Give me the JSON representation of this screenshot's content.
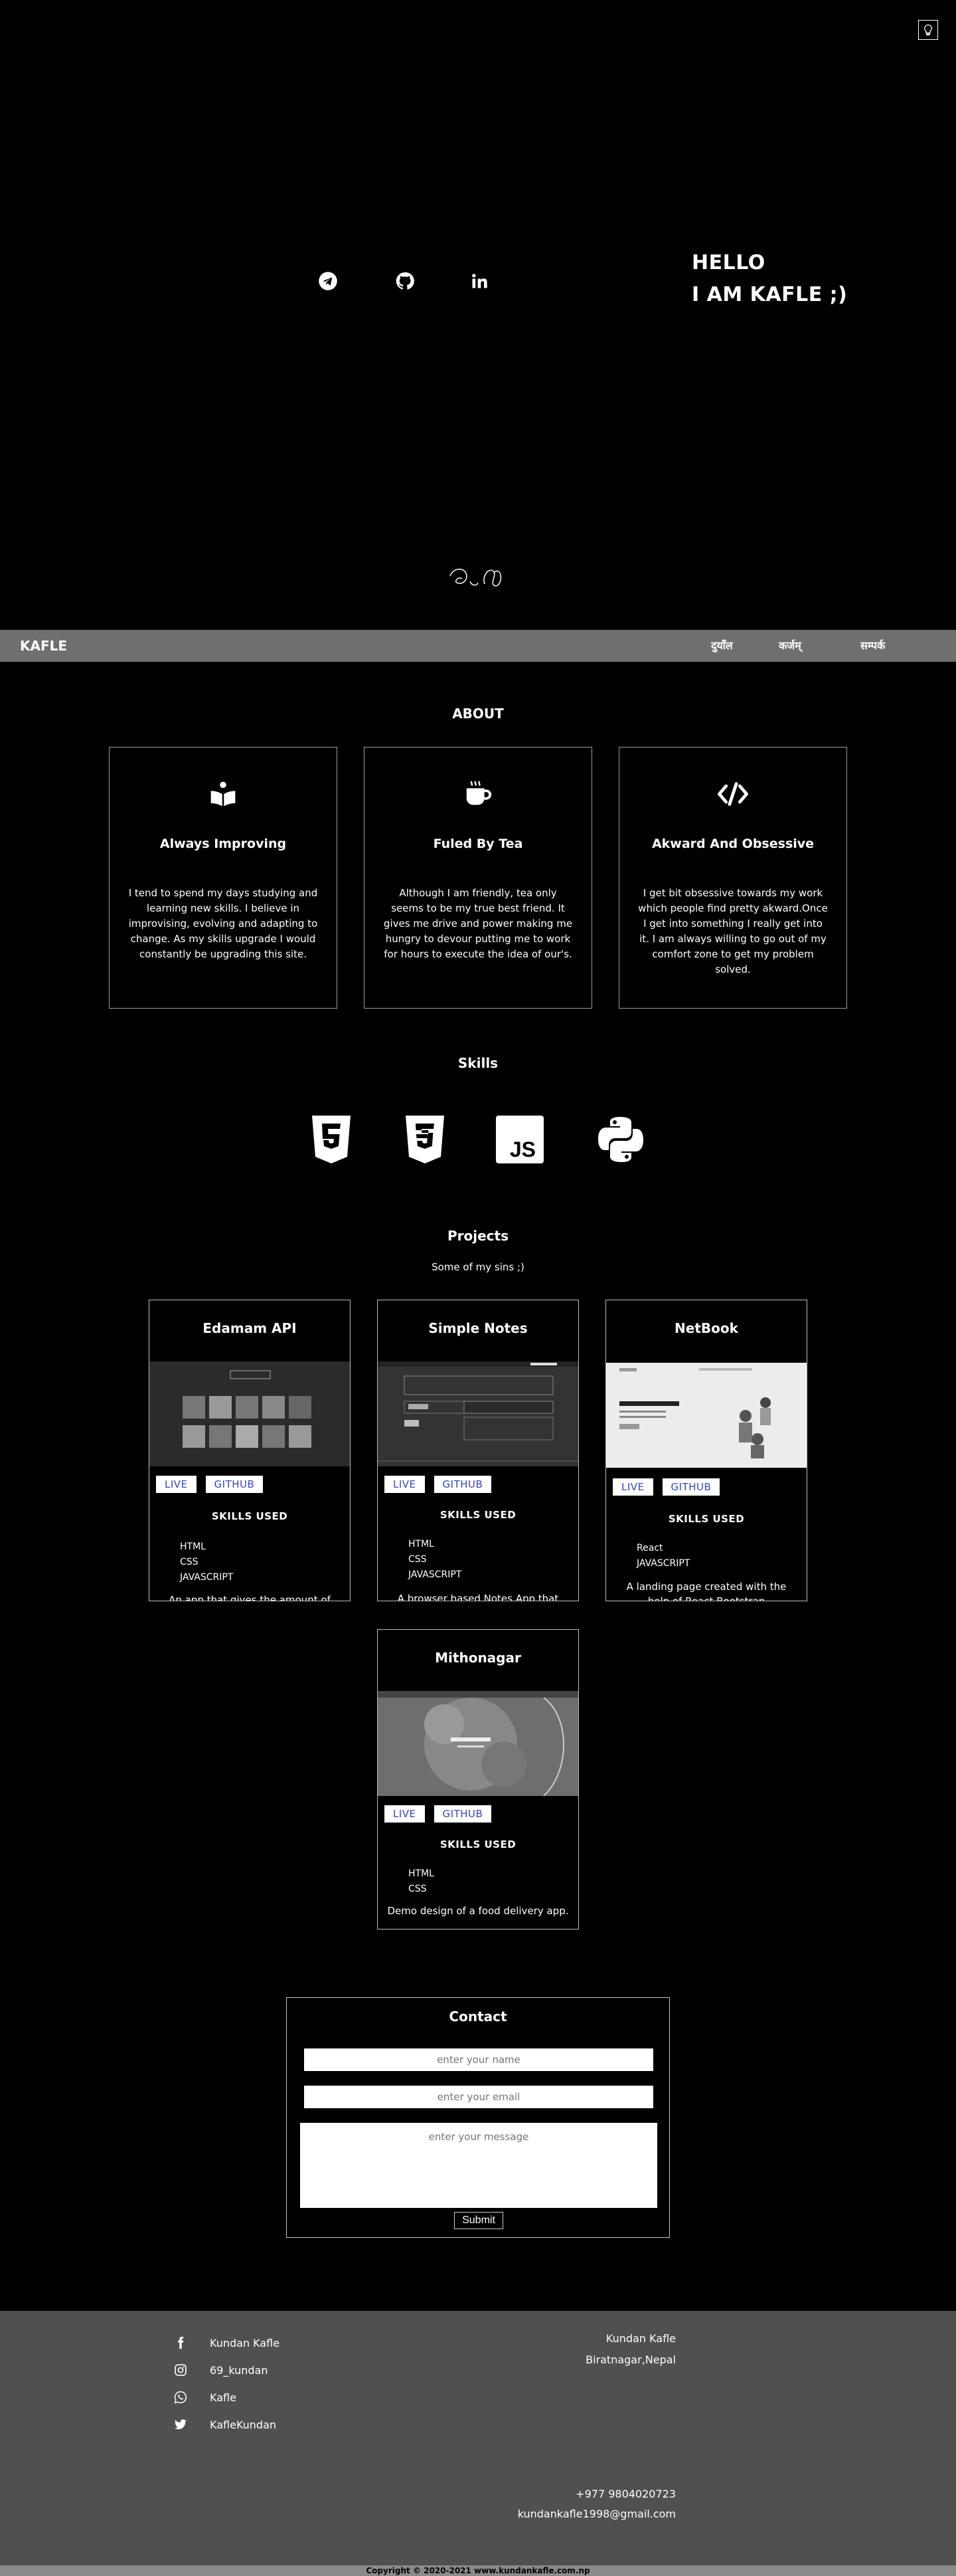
{
  "hero": {
    "line1": "HELLO",
    "line2": "I AM KAFLE ;)",
    "socials": [
      "telegram-icon",
      "github-icon",
      "linkedin-icon"
    ]
  },
  "nav": {
    "brand": "KAFLE",
    "links": [
      "दुयाँल",
      "कर्जम्",
      "सम्पर्क"
    ]
  },
  "about": {
    "title": "ABOUT",
    "cards": [
      {
        "icon": "book-reader-icon",
        "title": "Always Improving",
        "text": "I tend to spend my days studying and learning new skills. I believe in improvising, evolving and adapting to change. As my skills upgrade I would constantly be upgrading this site."
      },
      {
        "icon": "coffee-cup-icon",
        "title": "Fuled By Tea",
        "text": "Although I am friendly, tea only seems to be my true best friend. It gives me drive and power making me hungry to devour putting me to work for hours to execute the idea of our's."
      },
      {
        "icon": "code-icon",
        "title": "Akward And Obsessive",
        "text": "I get bit obsessive towards my work which people find pretty akward.Once I get into something I really get into it. I am always willing to go out of my comfort zone to get my problem solved."
      }
    ]
  },
  "skills": {
    "title": "Skills",
    "icons": [
      "html5-icon",
      "css3-icon",
      "javascript-icon",
      "python-icon"
    ]
  },
  "projects": {
    "title": "Projects",
    "subtitle": "Some of my sins ;)",
    "live_label": "LIVE",
    "github_label": "GITHUB",
    "skills_heading": "SKILLS USED",
    "items": [
      {
        "title": "Edamam API",
        "skills": [
          "HTML",
          "CSS",
          "JAVASCRIPT"
        ],
        "desc": "An app that gives the amount of"
      },
      {
        "title": "Simple Notes",
        "skills": [
          "HTML",
          "CSS",
          "JAVASCRIPT"
        ],
        "desc": "A browser based Notes App that"
      },
      {
        "title": "NetBook",
        "skills": [
          "React",
          "JAVASCRIPT"
        ],
        "desc": "A landing page created with the help of React Bootstrap"
      },
      {
        "title": "Mithonagar",
        "skills": [
          "HTML",
          "CSS"
        ],
        "desc": "Demo design of a food delivery app."
      }
    ]
  },
  "contact": {
    "title": "Contact",
    "name_placeholder": "enter your name",
    "email_placeholder": "enter your email",
    "message_placeholder": "enter your message",
    "submit_label": "Submit"
  },
  "footer": {
    "socials": [
      {
        "icon": "facebook-icon",
        "label": "Kundan Kafle"
      },
      {
        "icon": "instagram-icon",
        "label": "69_kundan"
      },
      {
        "icon": "whatsapp-icon",
        "label": "Kafle"
      },
      {
        "icon": "twitter-icon",
        "label": "KafleKundan"
      }
    ],
    "name": "Kundan Kafle",
    "location": "Biratnagar,Nepal",
    "phone": "+977 9804020723",
    "email": "kundankafle1998@gmail.com",
    "copyright": "Copyright © 2020-2021 www.kundankafle.com.np"
  }
}
